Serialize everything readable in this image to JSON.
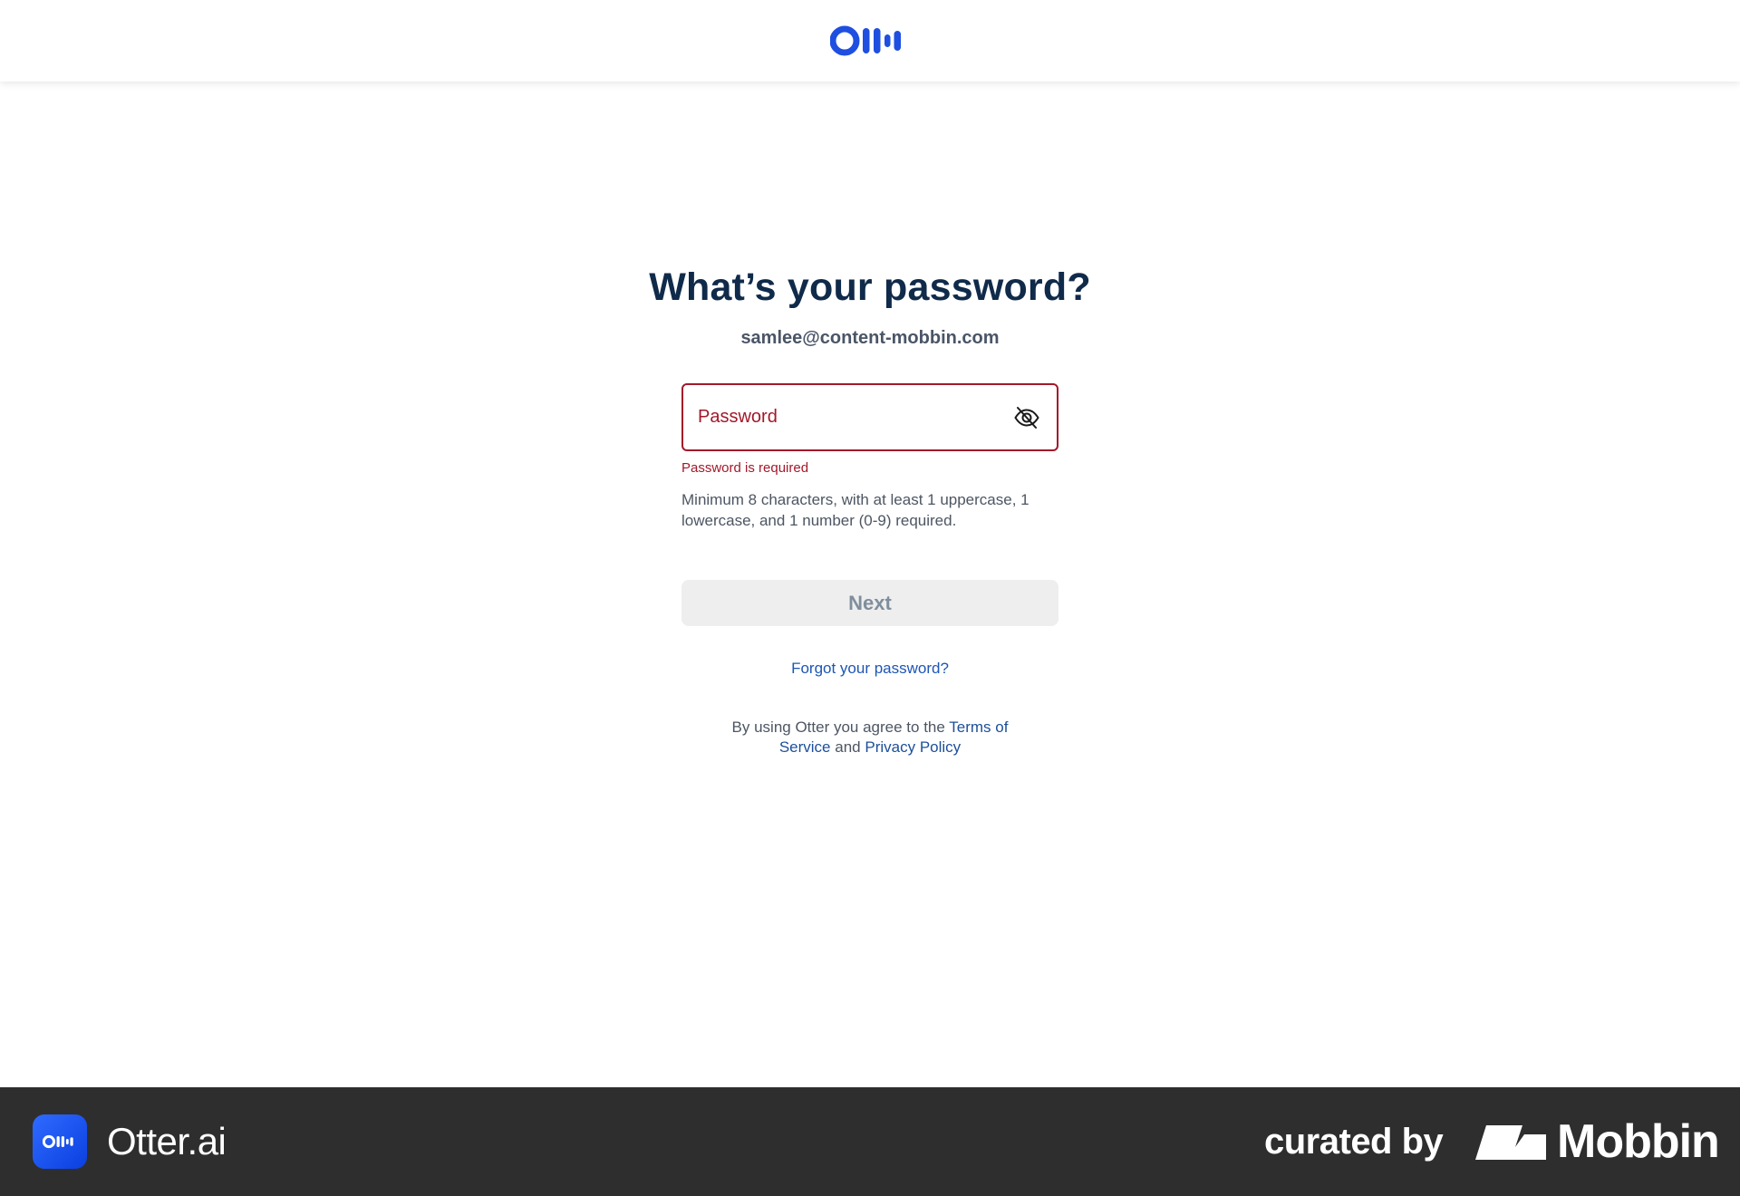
{
  "header": {
    "logo_icon": "otter-logo-icon",
    "brand_color": "#1f4fe0"
  },
  "form": {
    "title": "What’s your password?",
    "email": "samlee@content-mobbin.com",
    "password_placeholder": "Password",
    "password_value": "",
    "visibility_icon": "eye-off-icon",
    "error_message": "Password is required",
    "hint": "Minimum 8 characters, with at least 1 uppercase, 1 lowercase, and 1 number (0-9) required.",
    "next_label": "Next",
    "forgot_label": "Forgot your password?",
    "terms_prefix": "By using Otter you agree to the",
    "terms_link": "Terms of Service",
    "terms_and": "and",
    "privacy_link": "Privacy Policy",
    "error_color": "#a3182a",
    "link_color": "#1d56b5"
  },
  "footer": {
    "app_name": "Otter.ai",
    "curated_by": "curated by",
    "mobbin_name": "Mobbin",
    "background_color": "#2e2e2e"
  }
}
